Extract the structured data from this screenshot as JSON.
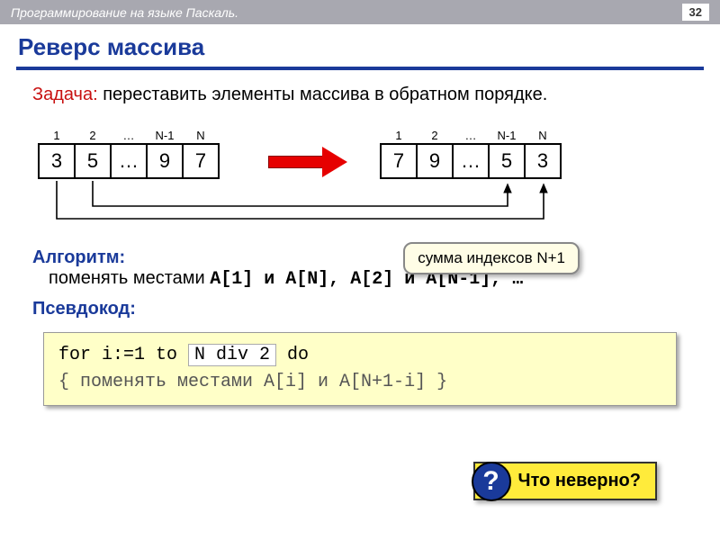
{
  "header": {
    "course": "Программирование на языке Паскаль.",
    "page": "32"
  },
  "title": "Реверс массива",
  "task": {
    "label": "Задача:",
    "text": " переставить элементы массива в обратном порядке."
  },
  "array": {
    "indices": [
      "1",
      "2",
      "…",
      "N-1",
      "N"
    ],
    "before": [
      "3",
      "5",
      "…",
      "9",
      "7"
    ],
    "after": [
      "7",
      "9",
      "…",
      "5",
      "3"
    ]
  },
  "algorithm": {
    "label": "Алгоритм:",
    "text_prefix": "поменять местами ",
    "text_mono": "A[1] и A[N], A[2] и A[N-1], …",
    "sum_note": "сумма индексов N+1"
  },
  "pseudocode_label": "Псевдокод:",
  "code": {
    "line1a": "for i:=1 to ",
    "hl": "N div 2",
    "line1b": " do",
    "line2": " { поменять местами A[i] и A[N+1-i] }"
  },
  "question": {
    "mark": "?",
    "text": "Что неверно?"
  }
}
